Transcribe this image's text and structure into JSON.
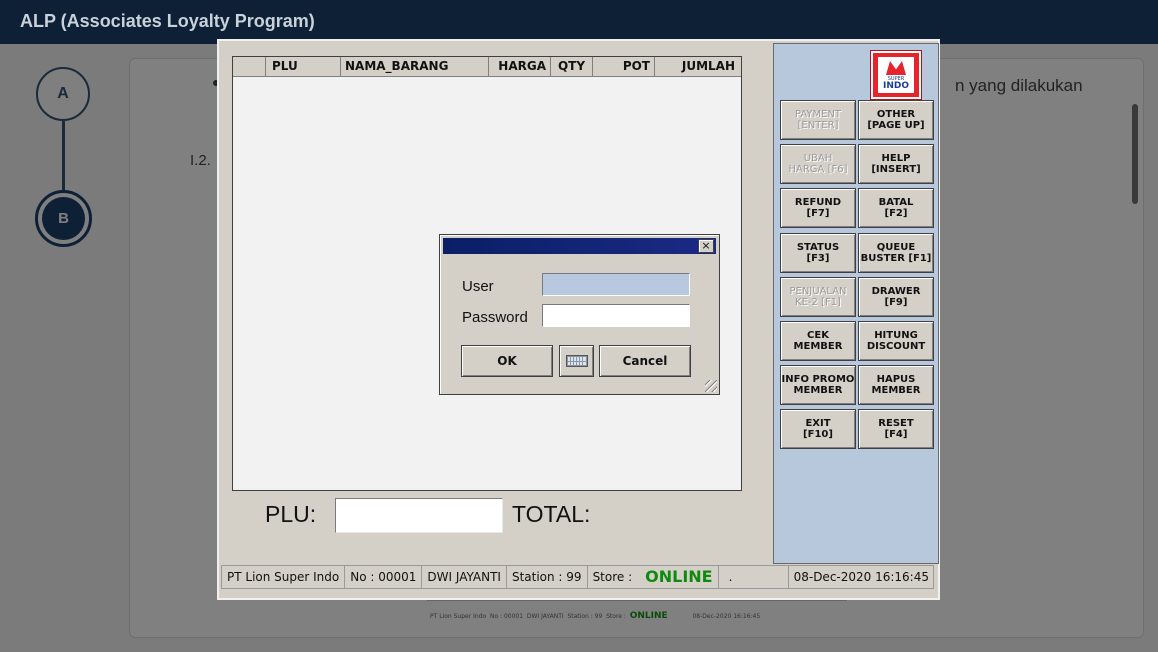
{
  "app": {
    "title": "ALP (Associates Loyalty Program)"
  },
  "background": {
    "step_a": "A",
    "step_b": "B",
    "text_right": "n yang dilakukan",
    "text_item": "I.2.",
    "mini_status": {
      "company": "PT Lion Super Indo",
      "no": "No : 00001",
      "user": "DWI JAYANTI",
      "station": "Station : 99",
      "store": "Store :",
      "status": "ONLINE",
      "datetime": "08-Dec-2020 16:16:45"
    }
  },
  "pos": {
    "grid_columns": [
      "",
      "PLU",
      "NAMA_BARANG",
      "HARGA",
      "QTY",
      "POT",
      "JUMLAH"
    ],
    "plu_label": "PLU:",
    "total_label": "TOTAL:",
    "logo": {
      "small": "SUPER",
      "word": "INDO",
      "brand_color": "#e5242b"
    },
    "buttons": [
      {
        "label": "PAYMENT\n[ENTER]",
        "disabled": true
      },
      {
        "label": "OTHER\n[PAGE UP]",
        "disabled": false
      },
      {
        "label": "UBAH\nHARGA [F6]",
        "disabled": true
      },
      {
        "label": "HELP\n[INSERT]",
        "disabled": false
      },
      {
        "label": "REFUND\n[F7]",
        "disabled": false
      },
      {
        "label": "BATAL\n[F2]",
        "disabled": false
      },
      {
        "label": "STATUS\n[F3]",
        "disabled": false
      },
      {
        "label": "QUEUE\nBUSTER [F1]",
        "disabled": false
      },
      {
        "label": "PENJUALAN\nKE-2 [F1]",
        "disabled": true
      },
      {
        "label": "DRAWER\n[F9]",
        "disabled": false
      },
      {
        "label": "CEK\nMEMBER",
        "disabled": false
      },
      {
        "label": "HITUNG\nDISCOUNT",
        "disabled": false
      },
      {
        "label": "INFO PROMO\nMEMBER",
        "disabled": false
      },
      {
        "label": "HAPUS\nMEMBER",
        "disabled": false
      },
      {
        "label": "EXIT\n[F10]",
        "disabled": false
      },
      {
        "label": "RESET\n[F4]",
        "disabled": false
      }
    ],
    "status": {
      "company": "PT Lion Super Indo",
      "no": "No : 00001",
      "user": "DWI JAYANTI",
      "station": "Station : 99",
      "store": "Store :",
      "online": "ONLINE",
      "dot": ".",
      "datetime": "08-Dec-2020 16:16:45",
      "online_color": "#0f8a0f"
    }
  },
  "login": {
    "close": "×",
    "user_label": "User",
    "password_label": "Password",
    "user_value": "",
    "password_value": "",
    "ok": "OK",
    "cancel": "Cancel",
    "keyboard_icon": "keyboard-icon"
  }
}
